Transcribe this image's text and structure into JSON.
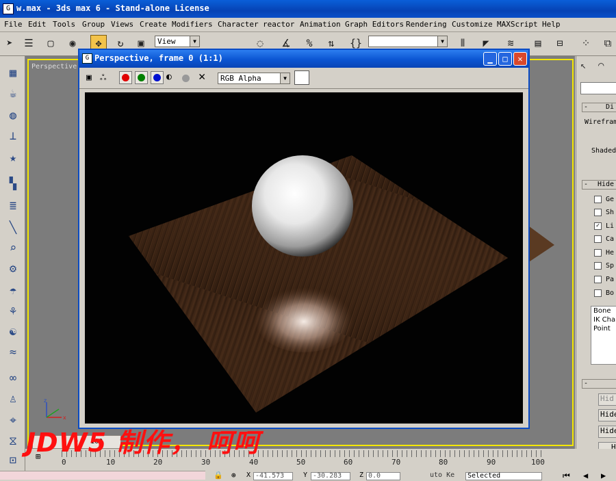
{
  "window": {
    "title": "w.max - 3ds max 6 - Stand-alone License"
  },
  "menu": [
    "File",
    "Edit",
    "Tools",
    "Group",
    "Views",
    "Create",
    "Modifiers",
    "Character",
    "reactor",
    "Animation",
    "Graph Editors",
    "Rendering",
    "Customize",
    "MAXScript",
    "Help"
  ],
  "toolbar": {
    "view_combo": "View",
    "selection_combo": ""
  },
  "viewport": {
    "label": "Perspective"
  },
  "render_window": {
    "title": "Perspective, frame 0 (1:1)",
    "channel": "RGB Alpha"
  },
  "command_panel": {
    "rollout_display": "Di",
    "wireframe_label": "Wireframe",
    "shaded_label": "Shaded",
    "rollout_hide": "Hide",
    "checkboxes": [
      {
        "label": "Ge",
        "checked": false
      },
      {
        "label": "Sh",
        "checked": false
      },
      {
        "label": "Li",
        "checked": true
      },
      {
        "label": "Ca",
        "checked": false
      },
      {
        "label": "He",
        "checked": false
      },
      {
        "label": "Sp",
        "checked": false
      },
      {
        "label": "Pa",
        "checked": false
      },
      {
        "label": "Bo",
        "checked": false
      }
    ],
    "list_items": [
      "Bone",
      "IK Chai",
      "Point"
    ],
    "buttons": [
      "Hid",
      "Hide",
      "Hide",
      "H"
    ]
  },
  "timeline": {
    "slider": "0 / 100",
    "ticks": [
      "0",
      "10",
      "20",
      "30",
      "40",
      "50",
      "60",
      "70",
      "80",
      "90",
      "100"
    ]
  },
  "status": {
    "x_label": "X",
    "x_value": "-41.573",
    "y_label": "Y",
    "y_value": "-30.283",
    "z_label": "Z",
    "z_value": "0.0",
    "autokey": "uto Ke",
    "key_mode": "Selected"
  },
  "watermark": "JDW5 制作， 呵呵",
  "colors": {
    "viewport_border": "#f5e800",
    "title_blue": "#0a4bc4",
    "watermark": "#ff1010"
  }
}
